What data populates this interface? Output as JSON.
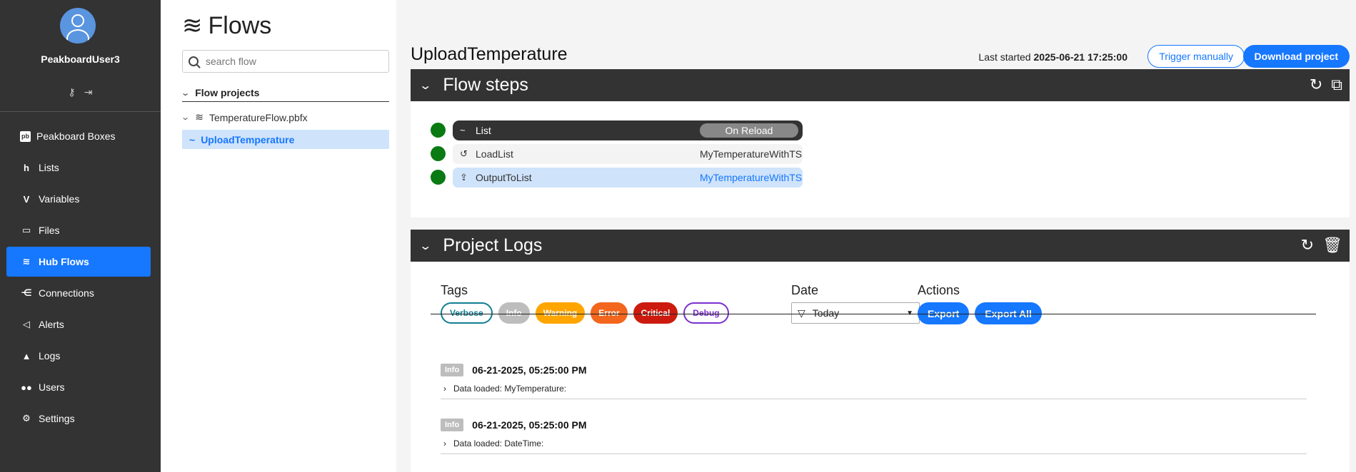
{
  "sidebar": {
    "username": "PeakboardUser3",
    "items": [
      {
        "label": "Peakboard Boxes",
        "icon": "pb-box-icon"
      },
      {
        "label": "Lists",
        "icon": "lists-icon"
      },
      {
        "label": "Variables",
        "icon": "variables-icon"
      },
      {
        "label": "Files",
        "icon": "folder-icon"
      },
      {
        "label": "Hub Flows",
        "icon": "flows-icon",
        "active": true
      },
      {
        "label": "Connections",
        "icon": "connections-icon"
      },
      {
        "label": "Alerts",
        "icon": "megaphone-icon"
      },
      {
        "label": "Logs",
        "icon": "warning-icon"
      },
      {
        "label": "Users",
        "icon": "users-icon"
      },
      {
        "label": "Settings",
        "icon": "gear-icon"
      }
    ]
  },
  "flows": {
    "title": "Flows",
    "search_placeholder": "search flow",
    "tree_header": "Flow projects",
    "project": "TemperatureFlow.pbfx",
    "flow": "UploadTemperature"
  },
  "main": {
    "flow_name": "UploadTemperature",
    "last_started_label": "Last started",
    "last_started_value": "2025-06-21 17:25:00",
    "trigger_label": "Trigger manually",
    "download_label": "Download project",
    "steps_title": "Flow steps",
    "steps": [
      {
        "name": "List",
        "value": "On Reload"
      },
      {
        "name": "LoadList",
        "value": "MyTemperatureWithTS"
      },
      {
        "name": "OutputToList",
        "value": "MyTemperatureWithTS"
      }
    ],
    "logs_title": "Project Logs",
    "tags_label": "Tags",
    "tags": [
      "Verbose",
      "Info",
      "Warning",
      "Error",
      "Critical",
      "Debug"
    ],
    "date_label": "Date",
    "date_value": "Today",
    "actions_label": "Actions",
    "export_label": "Export",
    "export_all_label": "Export All",
    "logs": [
      {
        "level": "Info",
        "time": "06-21-2025, 05:25:00 PM",
        "message": "Data loaded: MyTemperature:"
      },
      {
        "level": "Info",
        "time": "06-21-2025, 05:25:00 PM",
        "message": "Data loaded: DateTime:"
      }
    ]
  }
}
